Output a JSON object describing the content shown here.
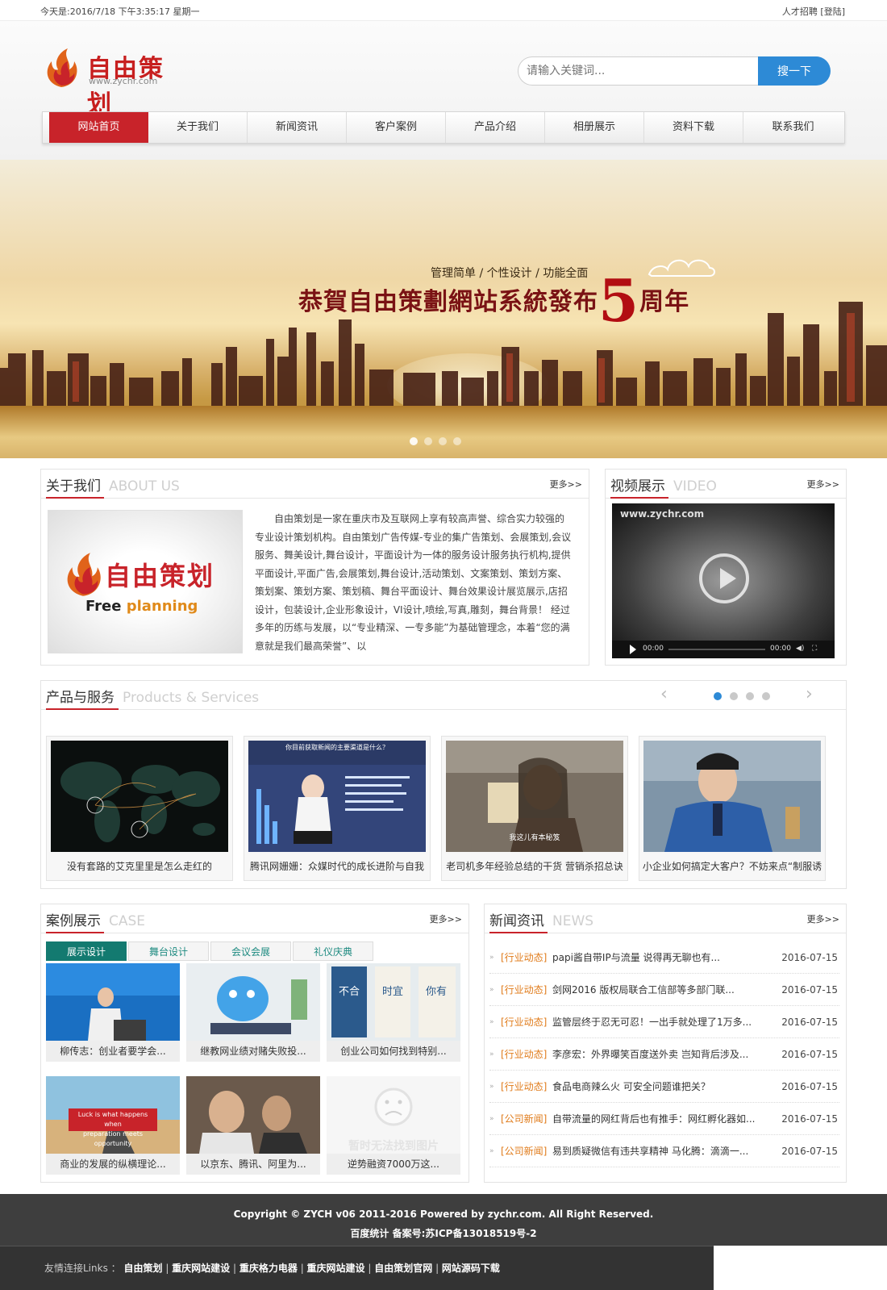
{
  "topbar": {
    "date_text": "今天是:2016/7/18 下午3:35:17 星期一",
    "recruit": "人才招聘",
    "login": "[登陆]"
  },
  "header": {
    "logo_text": "自由策划",
    "logo_url": "www.zychr.com",
    "search_placeholder": "请输入关键词...",
    "search_button": "搜一下"
  },
  "nav": [
    {
      "label": "网站首页",
      "active": true
    },
    {
      "label": "关于我们"
    },
    {
      "label": "新闻资讯"
    },
    {
      "label": "客户案例"
    },
    {
      "label": "产品介绍"
    },
    {
      "label": "相册展示"
    },
    {
      "label": "资料下载"
    },
    {
      "label": "联系我们"
    }
  ],
  "banner": {
    "slogan_small": "管理简单 / 个性设计 / 功能全面",
    "slogan_main_prefix": "恭賀自由策劃網站系統發布",
    "slogan_number": "5",
    "slogan_main_suffix": "周年"
  },
  "about": {
    "title": "关于我们",
    "title_en": "ABOUT US",
    "more": "更多>>",
    "image_brand": "自由策划",
    "image_sub_a": "Free",
    "image_sub_b": "planning",
    "text": "自由策划是一家在重庆市及互联网上享有较高声誉、综合实力较强的专业设计策划机构。自由策划广告传媒-专业的集广告策划、会展策划,会议服务、舞美设计,舞台设计，平面设计为一体的服务设计服务执行机构,提供平面设计,平面广告,会展策划,舞台设计,活动策划、文案策划、策划方案、策划案、策划方案、策划稿、舞台平面设计、舞台效果设计展览展示,店招设计，包装设计,企业形象设计，VI设计,喷绘,写真,雕刻，舞台背景！ 经过多年的历练与发展，以“专业精深、一专多能”为基础管理念，本着“您的满意就是我们最高荣誉”、以"
  },
  "video": {
    "title": "视频展示",
    "title_en": "VIDEO",
    "more": "更多>>",
    "watermark": "www.zychr.com",
    "time_current": "00:00",
    "time_total": "00:00"
  },
  "products": {
    "title": "产品与服务",
    "title_en": "Products & Services",
    "prev": "‹",
    "next": "›",
    "items": [
      {
        "caption": "没有套路的艾克里里是怎么走红的"
      },
      {
        "caption": "腾讯网姗姗：众媒时代的成长进阶与自我"
      },
      {
        "caption": "老司机多年经验总结的干货 营销杀招总诀"
      },
      {
        "caption": "小企业如何搞定大客户？不妨来点“制服诱"
      }
    ],
    "image2_headline": "你目前获取新闻的主要渠道是什么？",
    "image3_subtitle": "我这儿有本秘笈"
  },
  "cases": {
    "title": "案例展示",
    "title_en": "CASE",
    "more": "更多>>",
    "tabs": [
      "展示设计",
      "舞台设计",
      "会议会展",
      "礼仪庆典"
    ],
    "items": [
      {
        "caption": "柳传志：创业者要学会..."
      },
      {
        "caption": "继教网业绩对赌失败投..."
      },
      {
        "caption": "创业公司如何找到特别..."
      },
      {
        "caption": "商业的发展的纵横理论..."
      },
      {
        "caption": "以京东、腾讯、阿里为..."
      },
      {
        "caption": "逆势融资7000万这..."
      }
    ],
    "sign_line1": "Luck is what happens when",
    "sign_line2": "preparation meets opportunity",
    "no_image_text": "暂时无法找到图片",
    "banner_chars": [
      "不合",
      "时宜",
      "你有"
    ]
  },
  "news": {
    "title": "新闻资讯",
    "title_en": "NEWS",
    "more": "更多>>",
    "items": [
      {
        "tag": "[行业动态]",
        "title": "papi酱自带IP与流量 说得再无聊也有...",
        "date": "2016-07-15"
      },
      {
        "tag": "[行业动态]",
        "title": "剑网2016 版权局联合工信部等多部门联...",
        "date": "2016-07-15"
      },
      {
        "tag": "[行业动态]",
        "title": "监管层终于忍无可忍！一出手就处理了1万多...",
        "date": "2016-07-15"
      },
      {
        "tag": "[行业动态]",
        "title": "李彦宏：外界曝笑百度送外卖 岂知背后涉及...",
        "date": "2016-07-15"
      },
      {
        "tag": "[行业动态]",
        "title": "食品电商辣么火 可安全问题谁把关？",
        "date": "2016-07-15"
      },
      {
        "tag": "[公司新闻]",
        "title": "自带流量的网红背后也有推手：网红孵化器如...",
        "date": "2016-07-15"
      },
      {
        "tag": "[公司新闻]",
        "title": "易到质疑微信有违共享精神 马化腾：滴滴一...",
        "date": "2016-07-15"
      }
    ]
  },
  "footer": {
    "copyright": "Copyright © ZYCH v06 2011-2016 Powered by zychr.com. All Right Reserved.",
    "icp": "百度统计 备案号:苏ICP备13018519号-2",
    "links_label": "友情连接Links ：",
    "links": [
      "自由策划",
      "重庆网站建设",
      "重庆格力电器",
      "重庆网站建设",
      "自由策划官网",
      "网站源码下载"
    ]
  },
  "colors": {
    "accent_red": "#c8232a",
    "search_blue": "#2d8ad6",
    "tab_green": "#137a70",
    "tag_orange": "#e07b1a",
    "footer_bg": "#3e3e3e"
  }
}
